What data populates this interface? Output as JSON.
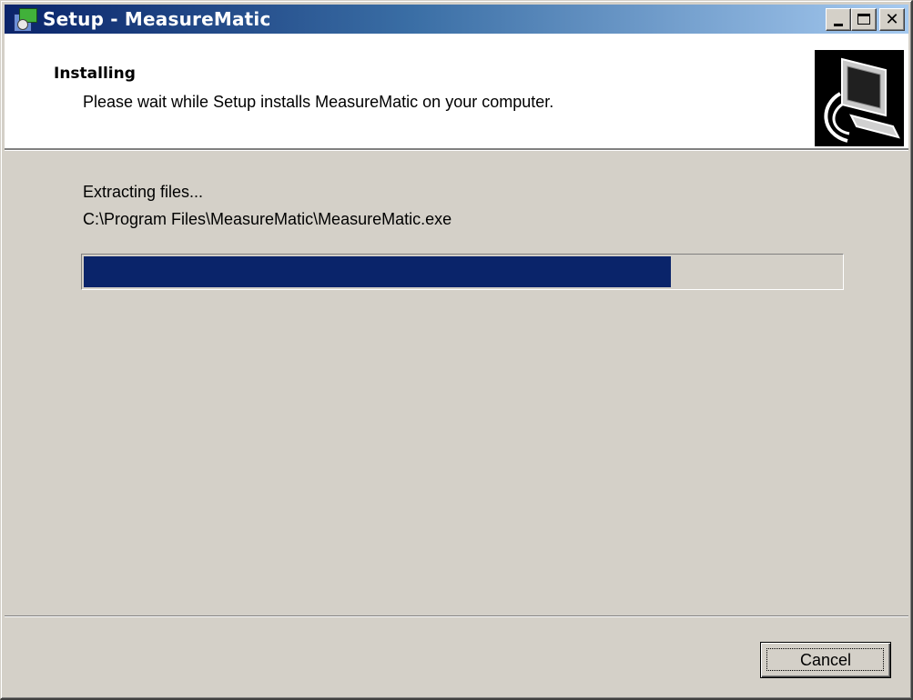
{
  "window": {
    "title": "Setup - MeasureMatic",
    "controls": {
      "minimize": "minimize",
      "maximize": "maximize",
      "close": "close"
    }
  },
  "header": {
    "title": "Installing",
    "subtitle": "Please wait while Setup installs MeasureMatic on your computer.",
    "image_icon": "computer-install-icon"
  },
  "status": {
    "line1": "Extracting files...",
    "line2": "C:\\Program Files\\MeasureMatic\\MeasureMatic.exe"
  },
  "progress": {
    "fraction": 0.775,
    "color": "#0a246a"
  },
  "footer": {
    "cancel_label": "Cancel"
  }
}
